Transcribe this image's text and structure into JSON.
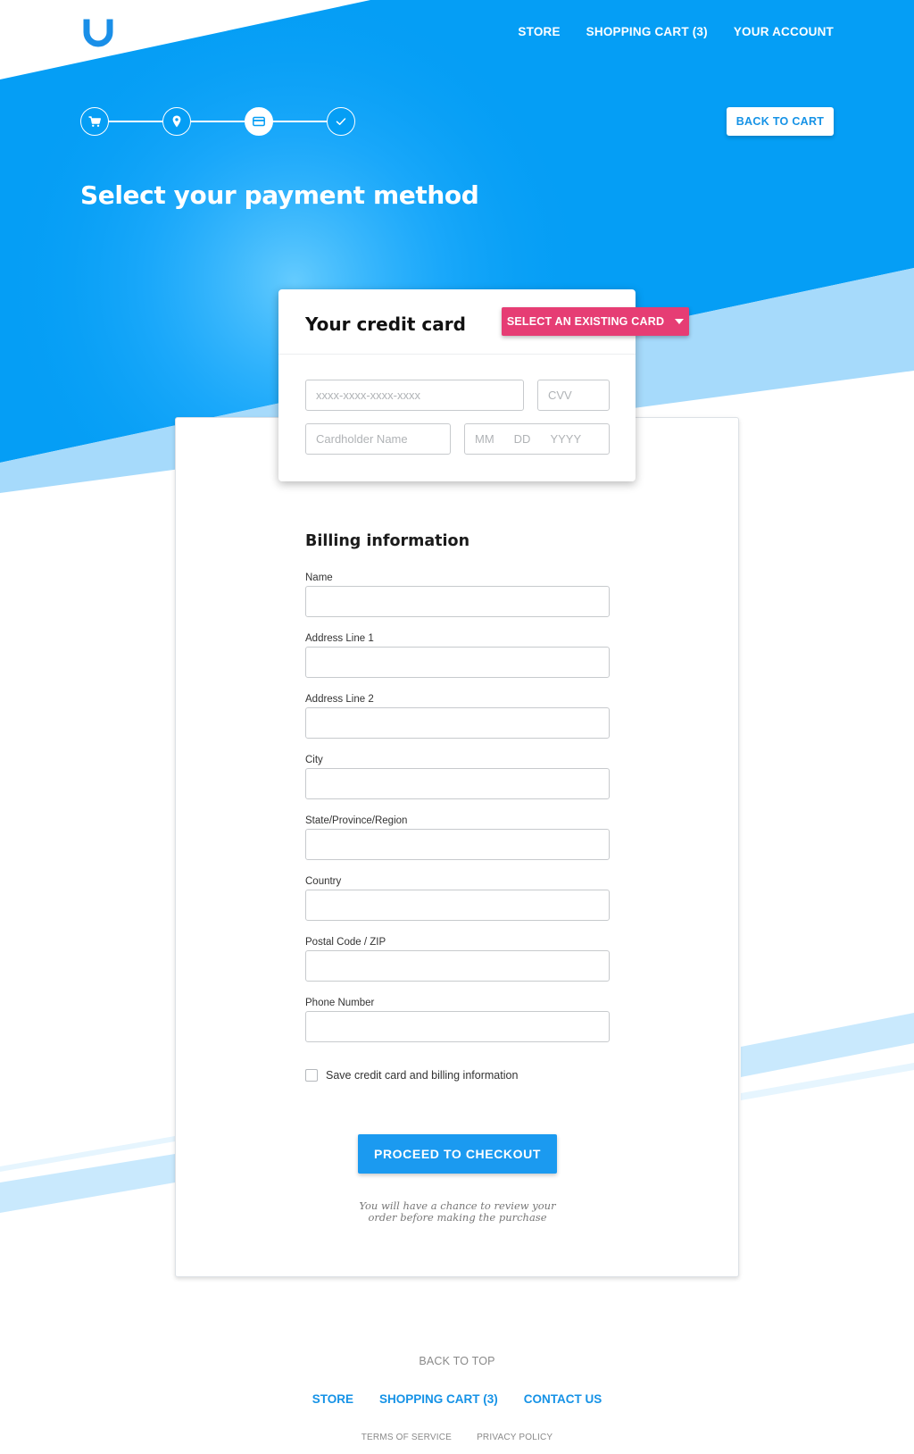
{
  "header": {
    "nav": [
      "STORE",
      "SHOPPING CART (3)",
      "YOUR ACCOUNT"
    ],
    "back_to_cart": "BACK TO CART",
    "steps": [
      {
        "icon": "cart-icon",
        "active": false
      },
      {
        "icon": "location-pin-icon",
        "active": false
      },
      {
        "icon": "credit-card-icon",
        "active": true
      },
      {
        "icon": "checkmark-icon",
        "active": false
      }
    ]
  },
  "page_title": "Select your payment method",
  "credit_card": {
    "title": "Your credit card",
    "select_existing": "SELECT AN EXISTING CARD",
    "card_number_placeholder": "xxxx-xxxx-xxxx-xxxx",
    "cvv_placeholder": "CVV",
    "cardholder_placeholder": "Cardholder Name",
    "date_parts": [
      "MM",
      "DD",
      "YYYY"
    ]
  },
  "billing": {
    "title": "Billing information",
    "fields": [
      "Name",
      "Address Line 1",
      "Address Line 2",
      "City",
      "State/Province/Region",
      "Country",
      "Postal Code / ZIP",
      "Phone Number"
    ],
    "save_label": "Save credit card and billing information"
  },
  "checkout": {
    "button": "PROCEED TO CHECKOUT",
    "note": "You will have a chance to review your order before making the purchase"
  },
  "footer": {
    "back_to_top": "BACK TO TOP",
    "nav": [
      "STORE",
      "SHOPPING CART (3)",
      "CONTACT US"
    ],
    "legal": [
      "TERMS OF SERVICE",
      "PRIVACY POLICY"
    ]
  },
  "colors": {
    "brand_blue": "#059ef5",
    "light_blue": "#a6dafb",
    "accent_pink": "#e63d74",
    "button_blue": "#1b9af0"
  }
}
